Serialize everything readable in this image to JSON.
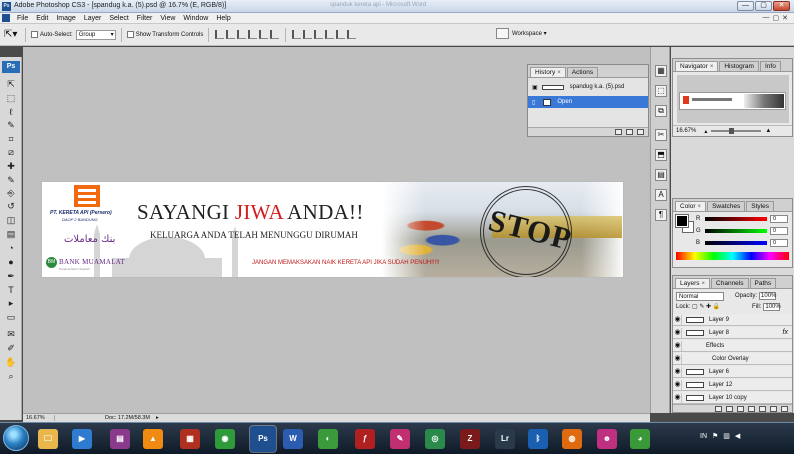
{
  "window": {
    "title": "Adobe Photoshop CS3 - [spandug k.a. (5).psd @ 16.7% (E, RGB/8)]",
    "ghost_title": "spanduk kereta api - Microsoft Word",
    "min": "—",
    "max": "▢",
    "close": "✕"
  },
  "menu": [
    "File",
    "Edit",
    "Image",
    "Layer",
    "Select",
    "Filter",
    "View",
    "Window",
    "Help"
  ],
  "menu_doc_controls": [
    "—",
    "▢",
    "✕"
  ],
  "options": {
    "auto_select_label": "Auto-Select:",
    "auto_select_value": "Group",
    "show_transform_label": "Show Transform Controls",
    "workspace_label": "Workspace ▾"
  },
  "toolbox": {
    "badge": "Ps",
    "tools": [
      "move-tool",
      "marquee-tool",
      "lasso-tool",
      "quick-select-tool",
      "crop-tool",
      "slice-tool",
      "healing-tool",
      "brush-tool",
      "clone-stamp-tool",
      "history-brush-tool",
      "eraser-tool",
      "gradient-tool",
      "blur-tool",
      "dodge-tool",
      "pen-tool",
      "type-tool",
      "path-select-tool",
      "shape-tool",
      "notes-tool",
      "eyedropper-tool",
      "hand-tool",
      "zoom-tool"
    ],
    "glyphs": [
      "⇱",
      "⬚",
      "ℓ",
      "✎",
      "⌗",
      "⧄",
      "✚",
      "✎",
      "⎆",
      "↺",
      "◫",
      "▤",
      "◔",
      "●",
      "✒",
      "T",
      "▸",
      "▭",
      "✉",
      "✐",
      "✋",
      "⌕"
    ]
  },
  "banner": {
    "company_name": "PT. KERETA API (Persero)",
    "company_sub": "DAOP 2 BANDUNG",
    "arabic": "بنك معاملات",
    "bm_logo": "BM",
    "bm_name": "BANK MUAMALAT",
    "bm_tagline": "Pertama Murni Syariah",
    "slogan_prefix": "SAYANGI ",
    "slogan_highlight": "JIWA",
    "slogan_suffix": " ANDA!!",
    "subline": "KELUARGA ANDA TELAH MENUNGGU DIRUMAH",
    "warning": "JANGAN MEMAKSAKAN NAIK KERETA API JIKA SUDAH PENUH!!!!!",
    "stamp": "STOP"
  },
  "history": {
    "tabs": [
      "History",
      "Actions"
    ],
    "close_mark": "×",
    "snapshot_name": "spandug k.a. (5).psd",
    "step": "Open"
  },
  "navigator": {
    "tabs": [
      "Navigator",
      "Histogram",
      "Info"
    ],
    "zoom": "16.67%",
    "close_mark": "×"
  },
  "color": {
    "tabs": [
      "Color",
      "Swatches",
      "Styles"
    ],
    "channels": [
      {
        "label": "R",
        "value": "0",
        "gradient": "linear-gradient(90deg,#000,#ff0000)"
      },
      {
        "label": "G",
        "value": "0",
        "gradient": "linear-gradient(90deg,#000,#00ff00)"
      },
      {
        "label": "B",
        "value": "0",
        "gradient": "linear-gradient(90deg,#000,#0000ff)"
      }
    ]
  },
  "layers": {
    "tabs": [
      "Layers",
      "Channels",
      "Paths"
    ],
    "blend_mode": "Normal",
    "opacity_label": "Opacity:",
    "opacity": "100%",
    "lock_label": "Lock:",
    "fill_label": "Fill:",
    "fill": "100%",
    "items": [
      {
        "name": "Layer 9",
        "fx": ""
      },
      {
        "name": "Layer 8",
        "fx": "fx"
      },
      {
        "name": "Effects",
        "fx": ""
      },
      {
        "name": "Color Overlay",
        "fx": ""
      },
      {
        "name": "Layer 6",
        "fx": ""
      },
      {
        "name": "Layer 12",
        "fx": ""
      },
      {
        "name": "Layer 10 copy",
        "fx": ""
      }
    ],
    "footer_icons": [
      "link-icon",
      "fx-icon",
      "mask-icon",
      "adjustment-icon",
      "group-icon",
      "new-layer-icon",
      "trash-icon"
    ]
  },
  "status": {
    "zoom": "16.67%",
    "doc": "Doc: 17.2M/58.3M",
    "arrow": "▸"
  },
  "taskbar": {
    "apps": [
      {
        "name": "explorer-icon",
        "glyph": "🗀",
        "color": "#e8b64a"
      },
      {
        "name": "media-player-icon",
        "glyph": "▶",
        "color": "#2e7bcf"
      },
      {
        "name": "winrar-icon",
        "glyph": "▤",
        "color": "#8a3a8a"
      },
      {
        "name": "vlc-icon",
        "glyph": "▲",
        "color": "#f08a10"
      },
      {
        "name": "reader-icon",
        "glyph": "▦",
        "color": "#b03020"
      },
      {
        "name": "utility-icon",
        "glyph": "◉",
        "color": "#2f9a3a"
      },
      {
        "name": "photoshop-icon",
        "glyph": "Ps",
        "color": "#1f4f8f"
      },
      {
        "name": "word-icon",
        "glyph": "W",
        "color": "#2b5cb0"
      },
      {
        "name": "corel-icon",
        "glyph": "◐",
        "color": "#3b9a3b"
      },
      {
        "name": "flash-icon",
        "glyph": "ƒ",
        "color": "#b02020"
      },
      {
        "name": "paint-icon",
        "glyph": "✎",
        "color": "#c03070"
      },
      {
        "name": "camtasia-icon",
        "glyph": "◎",
        "color": "#2a8a4a"
      },
      {
        "name": "illustrator-icon",
        "glyph": "Z",
        "color": "#7a1a1a"
      },
      {
        "name": "lightroom-icon",
        "glyph": "Lr",
        "color": "#2a3a4a"
      },
      {
        "name": "bluetooth-icon",
        "glyph": "ᛒ",
        "color": "#1a5fb0"
      },
      {
        "name": "firefox-icon",
        "glyph": "◍",
        "color": "#e06a10"
      },
      {
        "name": "game-icon",
        "glyph": "☻",
        "color": "#c03080"
      },
      {
        "name": "chrome-icon",
        "glyph": "◕",
        "color": "#3a9a3a"
      }
    ],
    "tray": {
      "lang": "IN",
      "flag": "⚑",
      "net": "▥",
      "vol": "◀"
    }
  }
}
